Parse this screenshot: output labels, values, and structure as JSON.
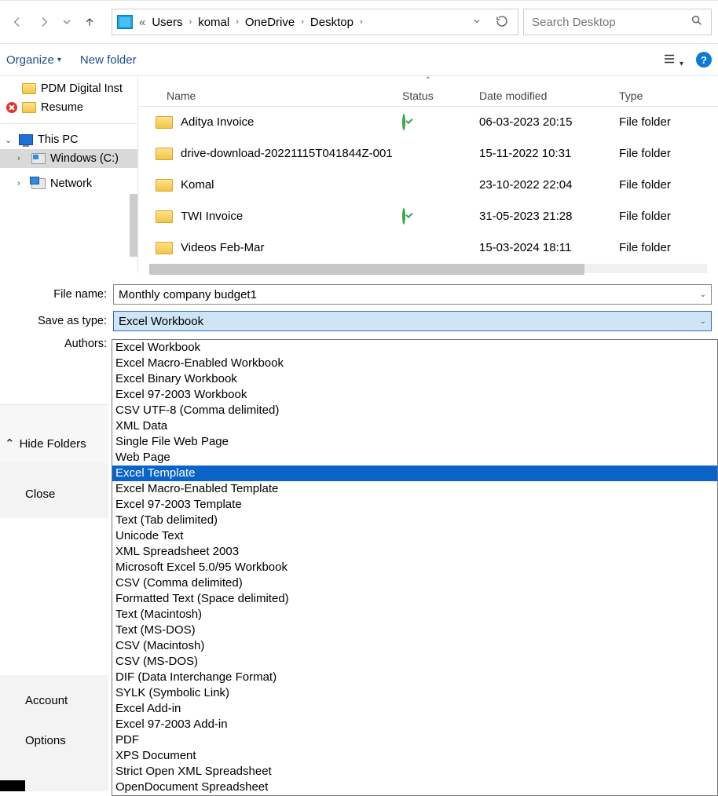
{
  "breadcrumbs": [
    "Users",
    "komal",
    "OneDrive",
    "Desktop"
  ],
  "search_placeholder": "Search Desktop",
  "toolbar": {
    "organize": "Organize",
    "new_folder": "New folder"
  },
  "sidebar": {
    "items": [
      {
        "label": "PDM Digital Inst",
        "icon": "folder"
      },
      {
        "label": "Resume",
        "icon": "folder",
        "error": true
      }
    ],
    "this_pc": "This PC",
    "drive": "Windows (C:)",
    "network": "Network"
  },
  "columns": {
    "name": "Name",
    "status": "Status",
    "date": "Date modified",
    "type": "Type"
  },
  "files": [
    {
      "name": "Aditya Invoice",
      "status": "ok",
      "date": "06-03-2023 20:15",
      "type": "File folder"
    },
    {
      "name": "drive-download-20221115T041844Z-001",
      "status": "err",
      "date": "15-11-2022 10:31",
      "type": "File folder"
    },
    {
      "name": "Komal",
      "status": "err",
      "date": "23-10-2022 22:04",
      "type": "File folder"
    },
    {
      "name": "TWI Invoice",
      "status": "ok",
      "date": "31-05-2023 21:28",
      "type": "File folder"
    },
    {
      "name": "Videos Feb-Mar",
      "status": "err",
      "date": "15-03-2024 18:11",
      "type": "File folder"
    }
  ],
  "form": {
    "file_name_label": "File name:",
    "file_name_value": "Monthly company budget1",
    "save_type_label": "Save as type:",
    "save_type_value": "Excel Workbook",
    "authors_label": "Authors:"
  },
  "actions": {
    "hide": "Hide Folders",
    "close": "Close",
    "account": "Account",
    "options": "Options"
  },
  "type_options": [
    "Excel Workbook",
    "Excel Macro-Enabled Workbook",
    "Excel Binary Workbook",
    "Excel 97-2003 Workbook",
    "CSV UTF-8 (Comma delimited)",
    "XML Data",
    "Single File Web Page",
    "Web Page",
    "Excel Template",
    "Excel Macro-Enabled Template",
    "Excel 97-2003 Template",
    "Text (Tab delimited)",
    "Unicode Text",
    "XML Spreadsheet 2003",
    "Microsoft Excel 5.0/95 Workbook",
    "CSV (Comma delimited)",
    "Formatted Text (Space delimited)",
    "Text (Macintosh)",
    "Text (MS-DOS)",
    "CSV (Macintosh)",
    "CSV (MS-DOS)",
    "DIF (Data Interchange Format)",
    "SYLK (Symbolic Link)",
    "Excel Add-in",
    "Excel 97-2003 Add-in",
    "PDF",
    "XPS Document",
    "Strict Open XML Spreadsheet",
    "OpenDocument Spreadsheet"
  ],
  "type_highlight_index": 8
}
